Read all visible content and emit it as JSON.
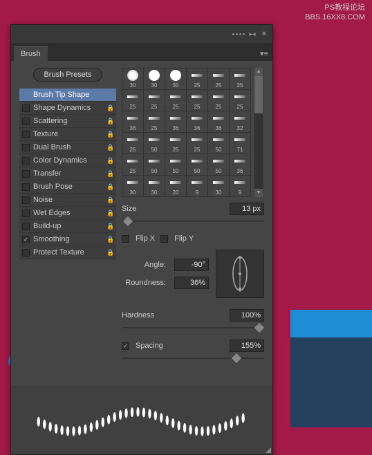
{
  "watermark": {
    "line1": "PS教程论坛",
    "line2": "BBS.16XX8.COM"
  },
  "panel": {
    "tab": "Brush",
    "presets_button": "Brush Presets",
    "options": [
      {
        "label": "Brush Tip Shape",
        "checkbox": false,
        "lock": false,
        "active": true
      },
      {
        "label": "Shape Dynamics",
        "checkbox": true,
        "checked": false,
        "lock": true
      },
      {
        "label": "Scattering",
        "checkbox": true,
        "checked": false,
        "lock": true
      },
      {
        "label": "Texture",
        "checkbox": true,
        "checked": false,
        "lock": true
      },
      {
        "label": "Dual Brush",
        "checkbox": true,
        "checked": false,
        "lock": true
      },
      {
        "label": "Color Dynamics",
        "checkbox": true,
        "checked": false,
        "lock": true
      },
      {
        "label": "Transfer",
        "checkbox": true,
        "checked": false,
        "lock": true
      },
      {
        "label": "Brush Pose",
        "checkbox": true,
        "checked": false,
        "lock": true
      },
      {
        "label": "Noise",
        "checkbox": true,
        "checked": false,
        "lock": true
      },
      {
        "label": "Wet Edges",
        "checkbox": true,
        "checked": false,
        "lock": true
      },
      {
        "label": "Build-up",
        "checkbox": true,
        "checked": false,
        "lock": true
      },
      {
        "label": "Smoothing",
        "checkbox": true,
        "checked": true,
        "lock": true
      },
      {
        "label": "Protect Texture",
        "checkbox": true,
        "checked": false,
        "lock": true
      }
    ],
    "thumbnails": [
      {
        "type": "soft",
        "size": "30"
      },
      {
        "type": "hard",
        "size": "30"
      },
      {
        "type": "hard",
        "size": "30"
      },
      {
        "type": "bar",
        "size": "25"
      },
      {
        "type": "bar",
        "size": "25"
      },
      {
        "type": "bar",
        "size": "25"
      },
      {
        "type": "bar",
        "size": "25"
      },
      {
        "type": "bar",
        "size": "25"
      },
      {
        "type": "bar",
        "size": "25"
      },
      {
        "type": "bar",
        "size": "25"
      },
      {
        "type": "bar",
        "size": "25"
      },
      {
        "type": "bar",
        "size": "25"
      },
      {
        "type": "bar",
        "size": "36"
      },
      {
        "type": "bar",
        "size": "25"
      },
      {
        "type": "bar",
        "size": "36"
      },
      {
        "type": "bar",
        "size": "36"
      },
      {
        "type": "bar",
        "size": "36"
      },
      {
        "type": "bar",
        "size": "32"
      },
      {
        "type": "bar",
        "size": "25"
      },
      {
        "type": "bar",
        "size": "50"
      },
      {
        "type": "bar",
        "size": "25"
      },
      {
        "type": "bar",
        "size": "25"
      },
      {
        "type": "bar",
        "size": "50"
      },
      {
        "type": "bar",
        "size": "71"
      },
      {
        "type": "bar",
        "size": "25"
      },
      {
        "type": "bar",
        "size": "50"
      },
      {
        "type": "bar",
        "size": "50"
      },
      {
        "type": "bar",
        "size": "50"
      },
      {
        "type": "bar",
        "size": "50"
      },
      {
        "type": "bar",
        "size": "36"
      },
      {
        "type": "bar",
        "size": "30"
      },
      {
        "type": "bar",
        "size": "30"
      },
      {
        "type": "bar",
        "size": "20"
      },
      {
        "type": "bar",
        "size": "9"
      },
      {
        "type": "bar",
        "size": "30"
      },
      {
        "type": "bar",
        "size": "9"
      }
    ],
    "size": {
      "label": "Size",
      "value": "13 px"
    },
    "flip_x": {
      "label": "Flip X",
      "checked": false
    },
    "flip_y": {
      "label": "Flip Y",
      "checked": false
    },
    "angle": {
      "label": "Angle:",
      "value": "-90°"
    },
    "roundness": {
      "label": "Roundness:",
      "value": "36%"
    },
    "hardness": {
      "label": "Hardness",
      "value": "100%"
    },
    "spacing": {
      "label": "Spacing",
      "checked": true,
      "value": "155%"
    }
  }
}
